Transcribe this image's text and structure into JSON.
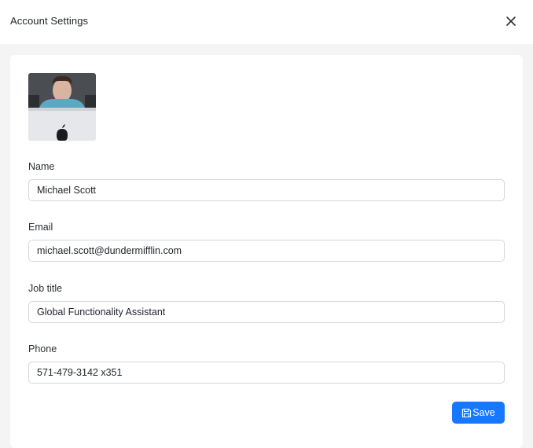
{
  "header": {
    "title": "Account Settings",
    "close_icon": "close-icon"
  },
  "profile": {
    "avatar_alt": "profile-photo"
  },
  "form": {
    "fields": [
      {
        "label": "Name",
        "value": "Michael Scott"
      },
      {
        "label": "Email",
        "value": "michael.scott@dundermifflin.com"
      },
      {
        "label": "Job title",
        "value": "Global Functionality Assistant"
      },
      {
        "label": "Phone",
        "value": "571-479-3142 x351"
      }
    ],
    "save_label": "Save",
    "save_icon": "save-icon"
  },
  "colors": {
    "accent": "#1677ff",
    "page_bg": "#f4f4f5",
    "card_bg": "#ffffff",
    "input_border": "#d4d7dc"
  }
}
